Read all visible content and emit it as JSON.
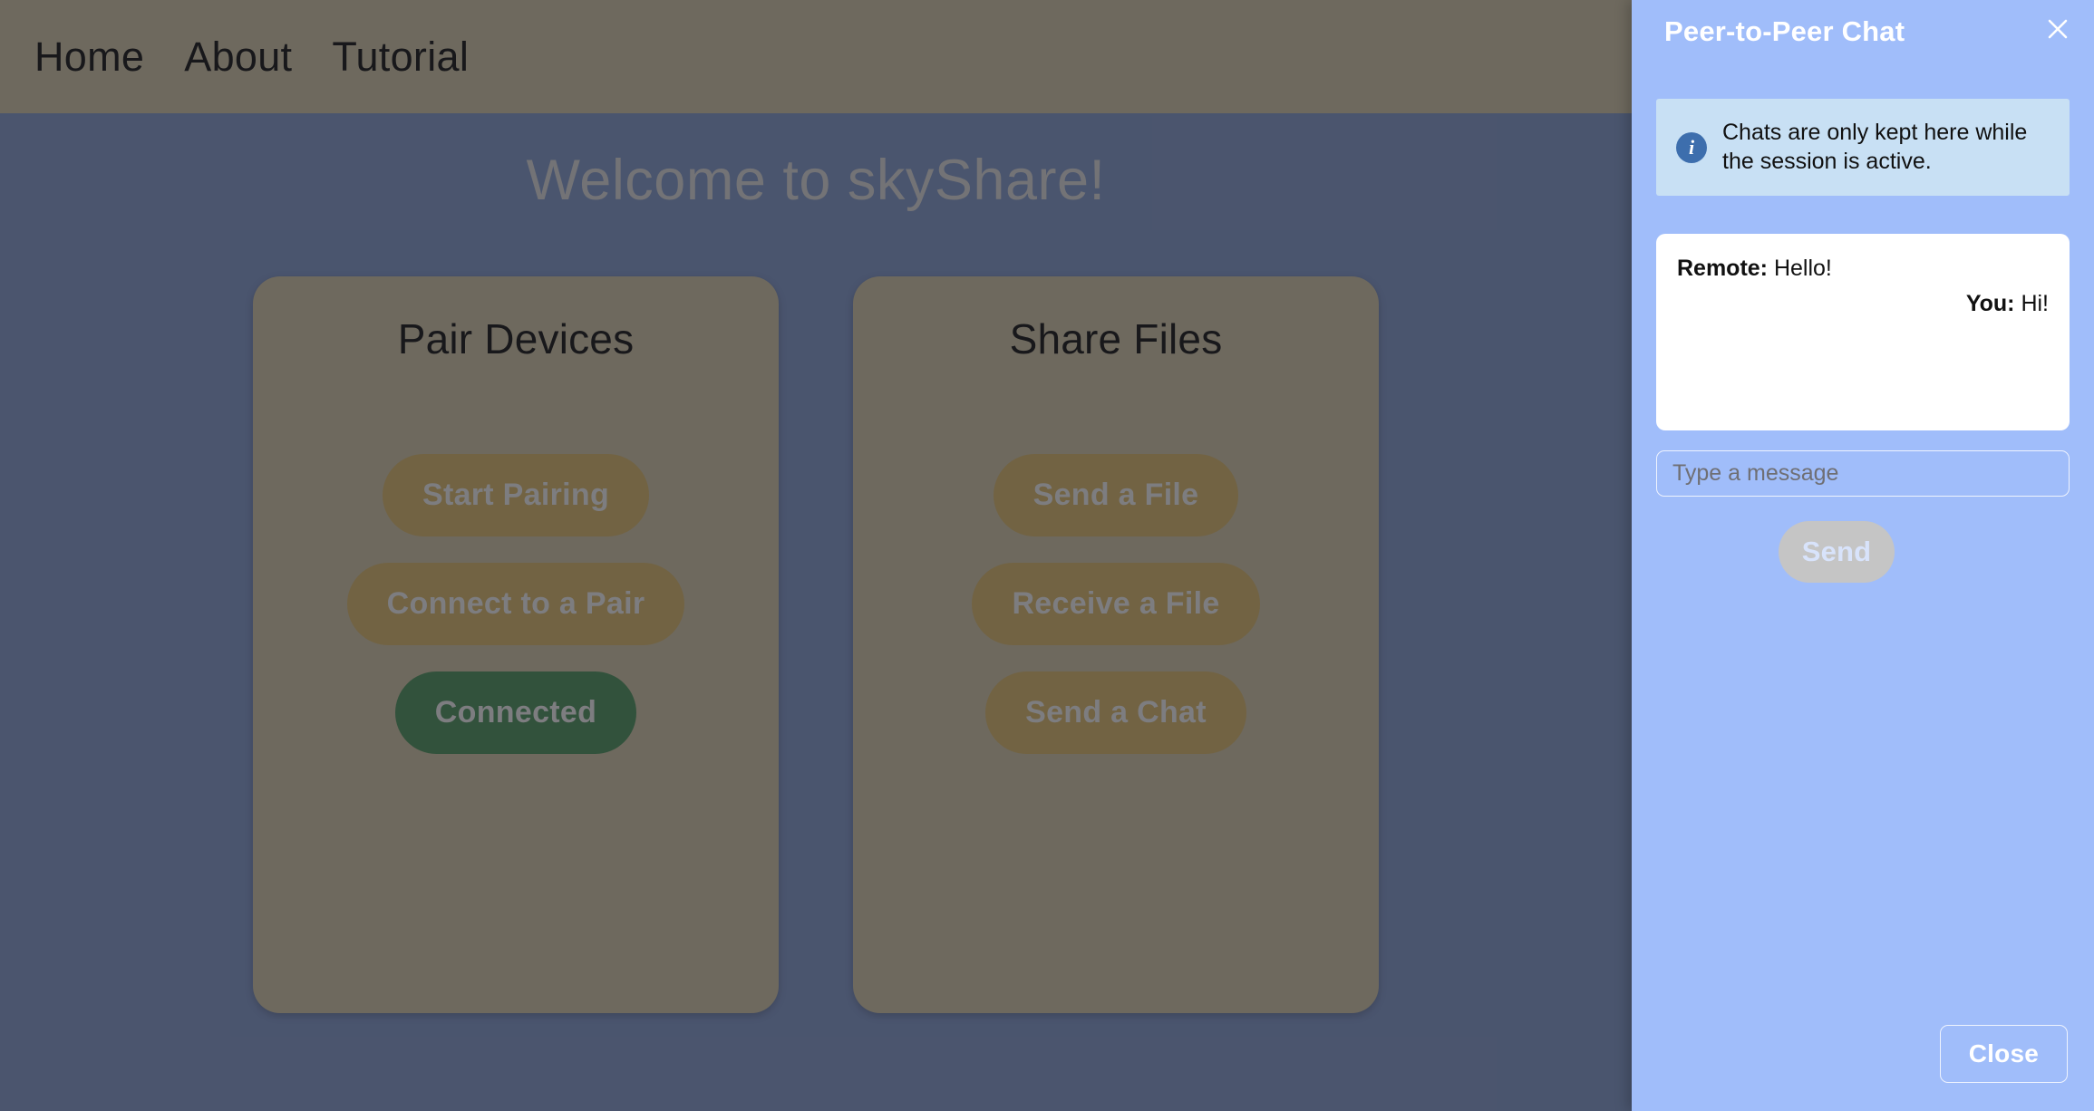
{
  "navbar": {
    "links": [
      {
        "label": "Home"
      },
      {
        "label": "About"
      },
      {
        "label": "Tutorial"
      }
    ]
  },
  "main": {
    "title": "Welcome to skyShare!",
    "cards": [
      {
        "title": "Pair Devices",
        "buttons": [
          {
            "label": "Start Pairing",
            "state": "default"
          },
          {
            "label": "Connect to a Pair",
            "state": "default"
          },
          {
            "label": "Connected",
            "state": "connected"
          }
        ]
      },
      {
        "title": "Share Files",
        "buttons": [
          {
            "label": "Send a File",
            "state": "default"
          },
          {
            "label": "Receive a File",
            "state": "default"
          },
          {
            "label": "Send a Chat",
            "state": "default"
          }
        ]
      }
    ]
  },
  "chat_panel": {
    "title": "Peer-to-Peer Chat",
    "close_icon": "close-icon",
    "info": {
      "icon": "info-circle-icon",
      "icon_glyph": "i",
      "text": "Chats are only kept here while the session is active."
    },
    "messages": [
      {
        "sender": "Remote:",
        "text": " Hello!",
        "align": "left"
      },
      {
        "sender": "You:",
        "text": " Hi!",
        "align": "right"
      }
    ],
    "input": {
      "value": "",
      "placeholder": "Type a message"
    },
    "send_label": "Send",
    "close_label": "Close"
  },
  "colors": {
    "navbar": "#847d69",
    "body": "#516080",
    "card": "#847d69",
    "button": "#8a7543",
    "connected": "#2f5c38",
    "panel": "#a0bdfa",
    "info_box": "#c8e0f4",
    "info_icon": "#3d6ead",
    "send_disabled": "#c5c5c5"
  }
}
